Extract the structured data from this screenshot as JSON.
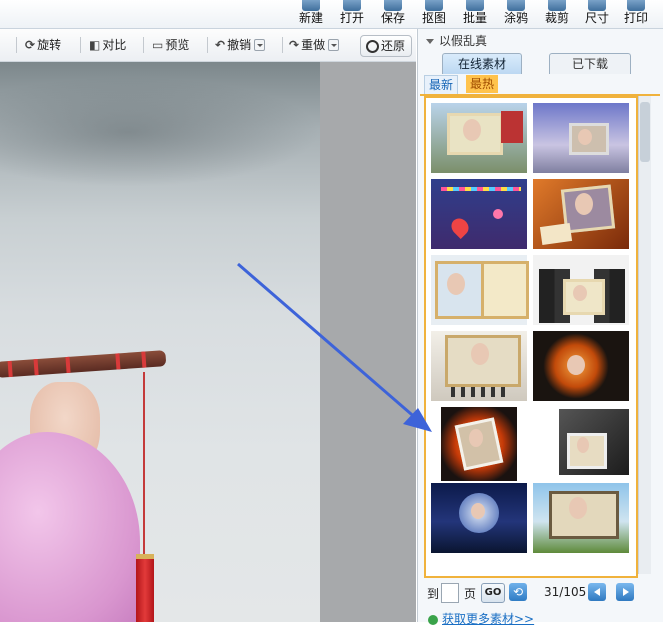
{
  "toolbar": {
    "items": [
      {
        "label": "新建",
        "icon": "new-icon"
      },
      {
        "label": "打开",
        "icon": "open-folder-icon"
      },
      {
        "label": "保存",
        "icon": "save-icon"
      },
      {
        "label": "抠图",
        "icon": "cutout-icon"
      },
      {
        "label": "批量",
        "icon": "batch-icon"
      },
      {
        "label": "涂鸦",
        "icon": "doodle-icon"
      },
      {
        "label": "裁剪",
        "icon": "crop-icon"
      },
      {
        "label": "尺寸",
        "icon": "resize-icon"
      },
      {
        "label": "打印",
        "icon": "print-icon"
      }
    ]
  },
  "editbar": {
    "rotate": "旋转",
    "compare": "对比",
    "preview": "预览",
    "undo": "撤销",
    "redo": "重做",
    "restore": "还原"
  },
  "panel": {
    "title": "以假乱真",
    "tabs": {
      "online": "在线素材",
      "downloaded": "已下载"
    },
    "subtabs": {
      "newest": "最新",
      "hottest": "最热"
    },
    "pager": {
      "goto_label": "到",
      "page_label": "页",
      "go": "GO",
      "page_value": "",
      "count": "31/105"
    },
    "more_link": "获取更多素材>>"
  },
  "colors": {
    "accent_orange": "#f0b23c",
    "link_blue": "#1a6fc4",
    "arrow_blue": "#3d63d9"
  }
}
